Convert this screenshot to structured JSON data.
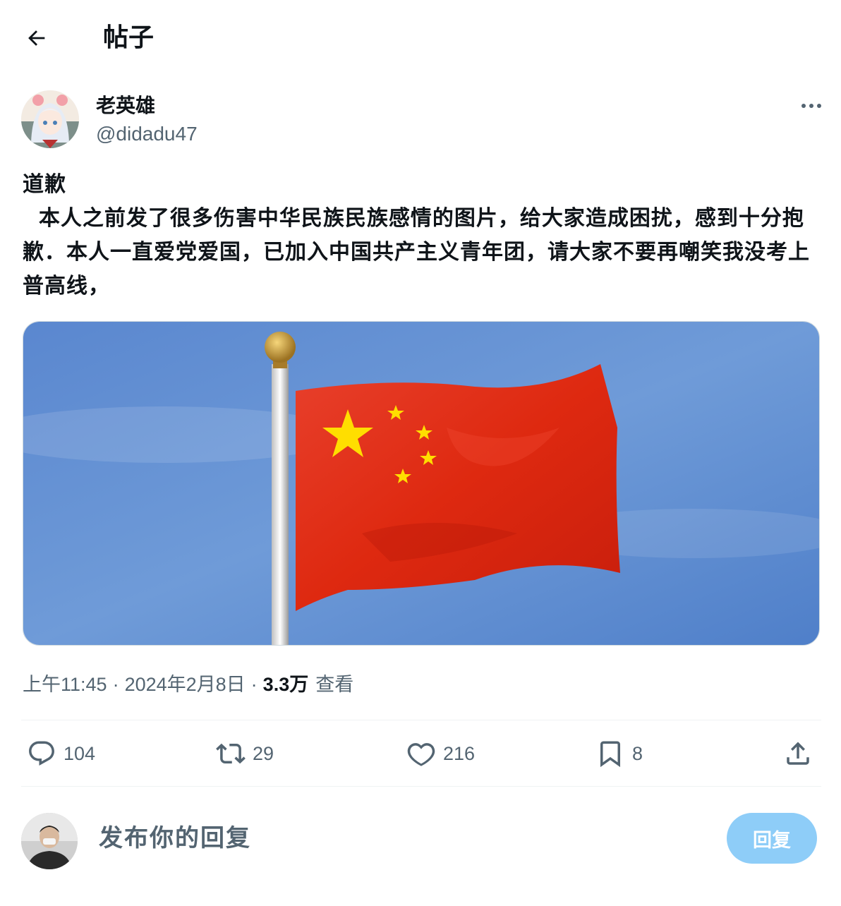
{
  "header": {
    "back_icon": "arrow-left-icon",
    "title": "帖子"
  },
  "author": {
    "name": "老英雄",
    "handle": "@didadu47",
    "more_icon": "more-horizontal-icon"
  },
  "post": {
    "text": "道歉\n  本人之前发了很多伤害中华民族民族感情的图片，给大家造成困扰，感到十分抱歉．本人一直爱党爱国，已加入中国共产主义青年团，请大家不要再嘲笑我没考上普高线，"
  },
  "meta": {
    "time": "上午11:45",
    "date": "2024年2月8日",
    "separator": "·",
    "views_count": "3.3万",
    "views_label": "查看"
  },
  "actions": {
    "replies": {
      "icon": "reply-bubble-icon",
      "count": "104"
    },
    "reposts": {
      "icon": "repost-icon",
      "count": "29"
    },
    "likes": {
      "icon": "heart-icon",
      "count": "216"
    },
    "bookmarks": {
      "icon": "bookmark-icon",
      "count": "8"
    },
    "share": {
      "icon": "share-upload-icon"
    }
  },
  "reply": {
    "placeholder": "发布你的回复",
    "button": "回复"
  },
  "colors": {
    "accent": "#1d9bf0",
    "reply_button_disabled": "#8ecdf8",
    "secondary_text": "#536471",
    "flag_red": "#de2910",
    "flag_yellow": "#ffde00"
  }
}
